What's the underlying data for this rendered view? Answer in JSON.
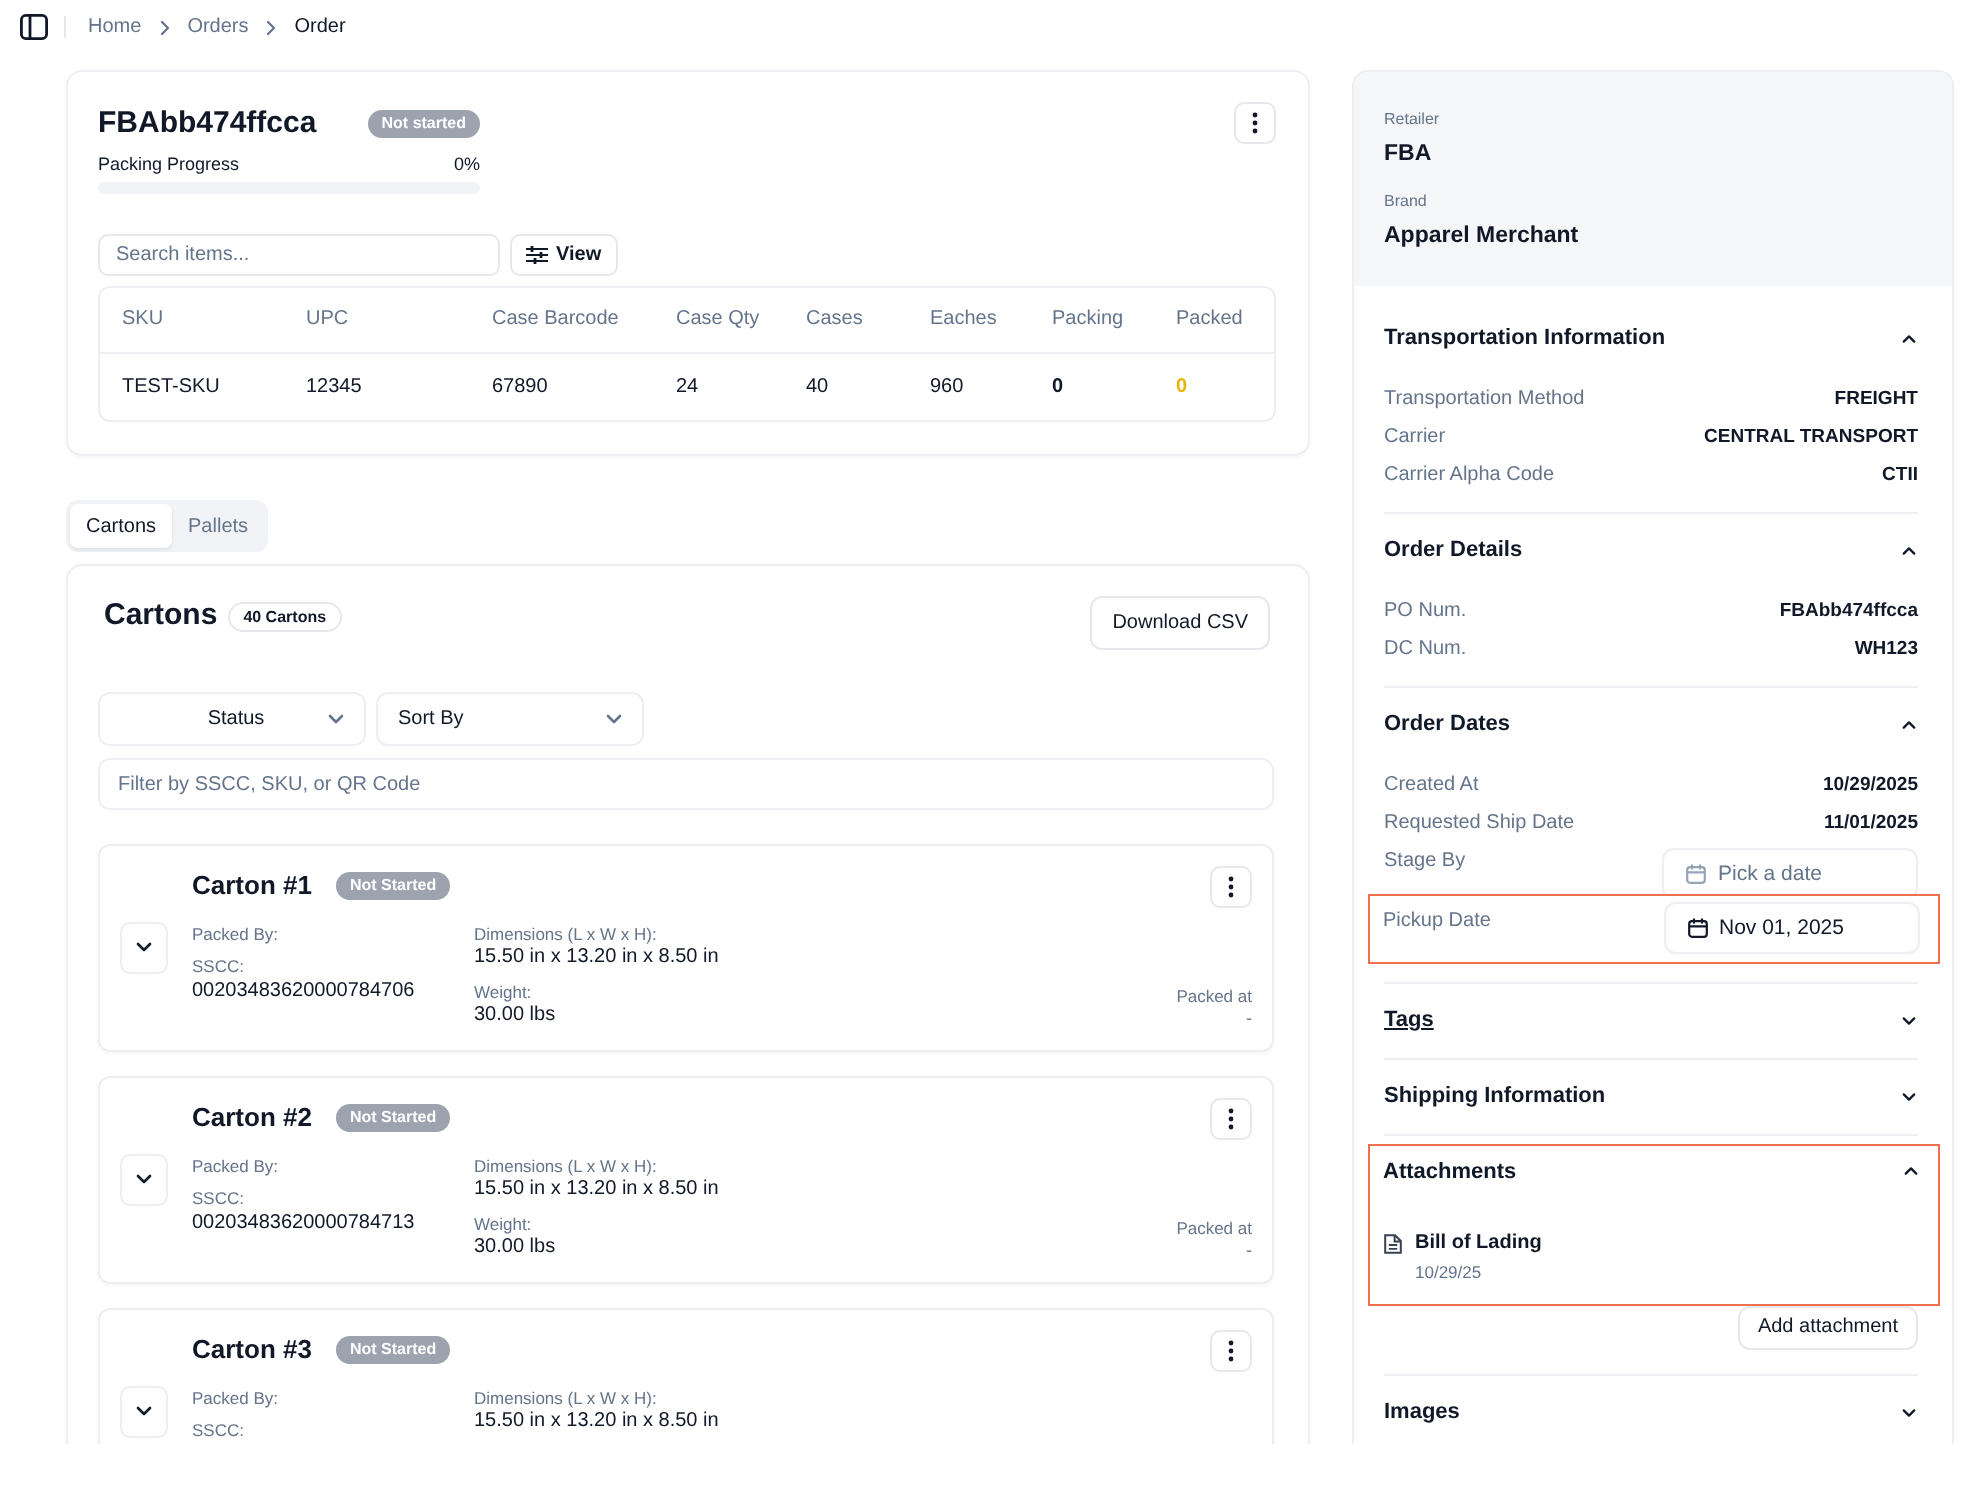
{
  "topbar": {
    "breadcrumb": [
      {
        "label": "Home",
        "current": false
      },
      {
        "label": "Orders",
        "current": false
      },
      {
        "label": "Order",
        "current": true
      }
    ]
  },
  "order": {
    "title": "FBAbb474ffcca",
    "status": "Not started",
    "progress_label": "Packing Progress",
    "progress_value": "0%",
    "level": 0,
    "search": {
      "placeholder": "Search items..."
    },
    "view_button": "View",
    "table": {
      "columns": [
        {
          "label": "SKU",
          "kind": "plain"
        },
        {
          "label": "UPC",
          "kind": "plain"
        },
        {
          "label": "Case Barcode",
          "kind": "plain"
        },
        {
          "label": "Case Qty",
          "kind": "plain"
        },
        {
          "label": "Cases",
          "kind": "plain"
        },
        {
          "label": "Eaches",
          "kind": "plain"
        },
        {
          "label": "Packing",
          "kind": "strong"
        },
        {
          "label": "Packed",
          "kind": "pending"
        }
      ],
      "rows": [
        {
          "cells": [
            "TEST-SKU",
            "12345",
            "67890",
            "24",
            "40",
            "960",
            "0",
            "0"
          ]
        }
      ]
    }
  },
  "tabs": [
    {
      "label": "Cartons",
      "selected": true
    },
    {
      "label": "Pallets",
      "selected": false
    }
  ],
  "cartons": {
    "title": "Cartons",
    "count": "40 Cartons",
    "download_button": "Download CSV",
    "filters": [
      {
        "label": "Status",
        "kind": "filter"
      },
      {
        "label": "Sort By",
        "kind": "sort"
      }
    ],
    "search": {
      "placeholder": "Filter by SSCC, SKU, or QR Code"
    },
    "items": [
      {
        "title": "Carton #1",
        "status": "Not Started",
        "expanded": false,
        "packed_by_label": "Packed By:",
        "sscc_label": "SSCC:",
        "sscc": "00203483620000784706",
        "dimensions_label": "Dimensions (L x W x H):",
        "dimensions": "15.50 in x 13.20 in x 8.50 in",
        "weight_label": "Weight:",
        "weight": "30.00 lbs",
        "packed_at_label": "Packed at",
        "packed_at": "-"
      },
      {
        "title": "Carton #2",
        "status": "Not Started",
        "expanded": false,
        "packed_by_label": "Packed By:",
        "sscc_label": "SSCC:",
        "sscc": "00203483620000784713",
        "dimensions_label": "Dimensions (L x W x H):",
        "dimensions": "15.50 in x 13.20 in x 8.50 in",
        "weight_label": "Weight:",
        "weight": "30.00 lbs",
        "packed_at_label": "Packed at",
        "packed_at": "-"
      },
      {
        "title": "Carton #3",
        "status": "Not Started",
        "expanded": false,
        "packed_by_label": "Packed By:",
        "sscc_label": "SSCC:",
        "dimensions_label": "Dimensions (L x W x H):",
        "dimensions": "15.50 in x 13.20 in x 8.50 in"
      }
    ]
  },
  "details": {
    "retailer_label": "Retailer",
    "retailer": "FBA",
    "brand_label": "Brand",
    "brand": "Apparel Merchant",
    "sections": [
      {
        "title": "Transportation Information",
        "expanded": true,
        "highlighted": false,
        "hovered": false,
        "rows": [
          {
            "kind": "text",
            "label": "Transportation Method",
            "value": "FREIGHT",
            "highlighted": false
          },
          {
            "kind": "text",
            "label": "Carrier",
            "value": "CENTRAL TRANSPORT",
            "highlighted": false
          },
          {
            "kind": "text",
            "label": "Carrier Alpha Code",
            "value": "CTII",
            "highlighted": false
          }
        ]
      },
      {
        "title": "Order Details",
        "expanded": true,
        "highlighted": false,
        "hovered": false,
        "rows": [
          {
            "kind": "text",
            "label": "PO Num.",
            "value": "FBAbb474ffcca",
            "highlighted": false
          },
          {
            "kind": "text",
            "label": "DC Num.",
            "value": "WH123",
            "highlighted": false
          }
        ]
      },
      {
        "title": "Order Dates",
        "expanded": true,
        "highlighted": false,
        "hovered": false,
        "rows": [
          {
            "kind": "text",
            "label": "Created At",
            "value": "10/29/2025",
            "highlighted": false
          },
          {
            "kind": "text",
            "label": "Requested Ship Date",
            "value": "11/01/2025",
            "highlighted": false
          },
          {
            "kind": "date",
            "label": "Stage By",
            "placeholder": "Pick a date",
            "highlighted": false
          },
          {
            "kind": "date",
            "label": "Pickup Date",
            "value": "Nov 01, 2025",
            "highlighted": true
          }
        ]
      },
      {
        "title": "Tags",
        "expanded": false,
        "highlighted": false,
        "hovered": true
      },
      {
        "title": "Shipping Information",
        "expanded": false,
        "highlighted": false,
        "hovered": false
      },
      {
        "title": "Attachments",
        "expanded": true,
        "highlighted": true,
        "hovered": false,
        "attachments": [
          {
            "name": "Bill of Lading",
            "date": "10/29/25"
          }
        ],
        "add_button": "Add attachment"
      },
      {
        "title": "Images",
        "expanded": false,
        "highlighted": false,
        "hovered": false
      }
    ]
  }
}
